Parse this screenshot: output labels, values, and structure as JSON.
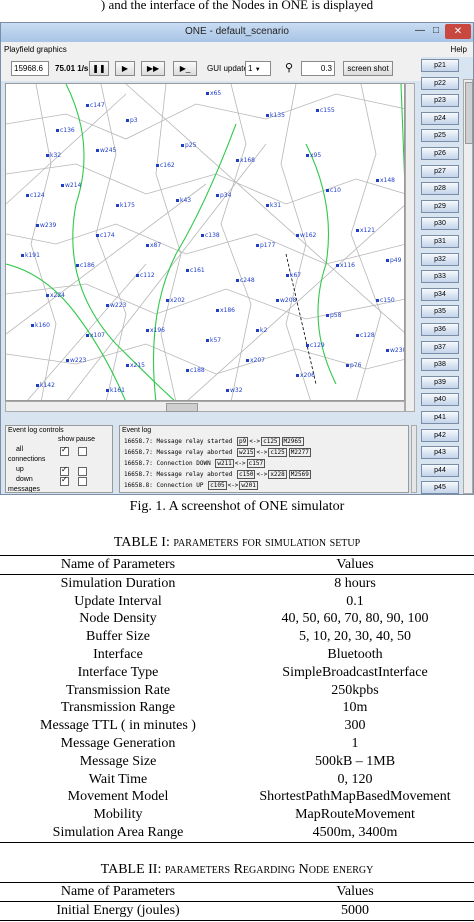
{
  "top_fragment": ") and the interface of the Nodes in ONE is displayed",
  "simulator": {
    "title": "ONE - default_scenario",
    "menu": {
      "left": "Playfield graphics",
      "right": "Help"
    },
    "toolbar": {
      "sim_time": "15968.6",
      "speed": "75.01 1/s",
      "gui_update_label": "GUI update:",
      "gui_update_value": "1",
      "zoom_value": "0.3",
      "screenshot_label": "screen shot"
    },
    "node_labels": [
      "c147",
      "x65",
      "c136",
      "p3",
      "k135",
      "c155",
      "p25",
      "k32",
      "w245",
      "c162",
      "x168",
      "x95",
      "c124",
      "w214",
      "k175",
      "k43",
      "p34",
      "k31",
      "c10",
      "x148",
      "w239",
      "c174",
      "x87",
      "c138",
      "p177",
      "w162",
      "x121",
      "k191",
      "c186",
      "c112",
      "c161",
      "c248",
      "k67",
      "x116",
      "p49",
      "x224",
      "w223",
      "x202",
      "x186",
      "w208",
      "p58",
      "c150",
      "k160",
      "x107",
      "x196",
      "k57",
      "k2",
      "c129",
      "c128",
      "w223",
      "x215",
      "c188",
      "x207",
      "x206",
      "p76",
      "w230",
      "k142",
      "k161",
      "w32"
    ],
    "node_buttons": [
      "p21",
      "p22",
      "p23",
      "p24",
      "p25",
      "p26",
      "p27",
      "p28",
      "p29",
      "p30",
      "p31",
      "p32",
      "p33",
      "p34",
      "p35",
      "p36",
      "p37",
      "p38",
      "p39",
      "p40",
      "p41",
      "p42",
      "p43",
      "p44",
      "p45"
    ],
    "event_controls": {
      "title": "Event log controls",
      "col_show": "show",
      "col_pause": "pause",
      "rows": [
        {
          "label": "all",
          "show": true,
          "pause": false
        },
        {
          "label": "connections",
          "show": null,
          "pause": null
        },
        {
          "label": "up",
          "show": true,
          "pause": false
        },
        {
          "label": "down",
          "show": true,
          "pause": false
        },
        {
          "label": "messages",
          "show": null,
          "pause": null
        }
      ]
    },
    "event_log": {
      "title": "Event log",
      "lines": [
        {
          "time": "16658.7:",
          "text": "Message relay started",
          "a": "p9",
          "arrow": "<->",
          "b": "c125",
          "c": "M2965"
        },
        {
          "time": "16658.7:",
          "text": "Message relay aborted",
          "a": "w215",
          "arrow": "<->",
          "b": "c125",
          "c": "M2277"
        },
        {
          "time": "16658.7:",
          "text": "Connection DOWN",
          "a": "w211",
          "arrow": "<->",
          "b": "c157",
          "c": ""
        },
        {
          "time": "16658.7:",
          "text": "Message relay aborted",
          "a": "c150",
          "arrow": "<->",
          "b": "x228",
          "c": "M2569"
        },
        {
          "time": "16658.8:",
          "text": "Connection UP",
          "a": "c105",
          "arrow": "<->",
          "b": "w201",
          "c": ""
        }
      ]
    }
  },
  "figure_caption": "Fig. 1. A screenshot of ONE simulator",
  "table1": {
    "label": "TABLE I:",
    "title": "parameters for simulation setup",
    "headers": [
      "Name of Parameters",
      "Values"
    ],
    "rows": [
      [
        "Simulation Duration",
        "8 hours"
      ],
      [
        "Update Interval",
        "0.1"
      ],
      [
        "Node Density",
        "40, 50, 60, 70, 80, 90, 100"
      ],
      [
        "Buffer Size",
        "5, 10, 20, 30, 40, 50"
      ],
      [
        "Interface",
        "Bluetooth"
      ],
      [
        "Interface Type",
        "SimpleBroadcastInterface"
      ],
      [
        "Transmission Rate",
        "250kpbs"
      ],
      [
        "Transmission Range",
        "10m"
      ],
      [
        "Message TTL ( in minutes )",
        "300"
      ],
      [
        "Message Generation",
        "1"
      ],
      [
        "Message Size",
        "500kB – 1MB"
      ],
      [
        "Wait Time",
        "0, 120"
      ],
      [
        "Movement Model",
        "ShortestPathMapBasedMovement"
      ],
      [
        "Mobility",
        "MapRouteMovement"
      ],
      [
        "Simulation Area Range",
        "4500m, 3400m"
      ]
    ]
  },
  "table2": {
    "label": "TABLE II:",
    "title": "parameters Regarding Node energy",
    "headers": [
      "Name of Parameters",
      "Values"
    ],
    "rows": [
      [
        "Initial Energy (joules)",
        "5000"
      ]
    ]
  }
}
